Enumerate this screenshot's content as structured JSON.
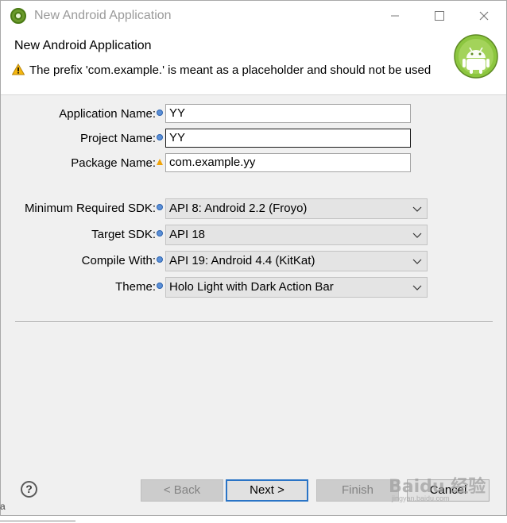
{
  "window": {
    "title": "New Android Application"
  },
  "banner": {
    "title": "New Android Application",
    "message": "The prefix 'com.example.' is meant as a placeholder and should not be used"
  },
  "form": {
    "application_name_label": "Application Name:",
    "application_name_value": "YY",
    "project_name_label": "Project Name:",
    "project_name_value": "YY",
    "package_name_label": "Package Name:",
    "package_name_value": "com.example.yy",
    "min_sdk_label": "Minimum Required SDK:",
    "min_sdk_value": "API 8: Android 2.2 (Froyo)",
    "target_sdk_label": "Target SDK:",
    "target_sdk_value": "API 18",
    "compile_with_label": "Compile With:",
    "compile_with_value": "API 19: Android 4.4 (KitKat)",
    "theme_label": "Theme:",
    "theme_value": "Holo Light with Dark Action Bar"
  },
  "buttons": {
    "help": "?",
    "back": "< Back",
    "next": "Next >",
    "finish": "Finish",
    "cancel": "Cancel"
  },
  "watermark": {
    "brand": "Baidu 经验",
    "url": "jingyan.baidu.com"
  },
  "outside_fragment": "a",
  "colors": {
    "accent": "#2a74c6",
    "warning": "#f0a30a",
    "info": "#5b8fd6",
    "android_green": "#8cc63f"
  }
}
